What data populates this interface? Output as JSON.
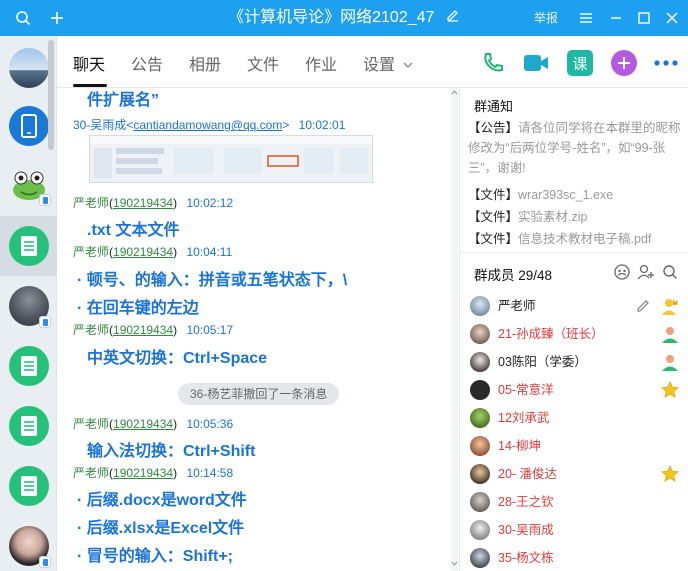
{
  "window": {
    "title": "《计算机导论》网络2102_47",
    "report": "举报",
    "colors": {
      "titlebar": "#1ea0f0",
      "accent": "#1a73d9",
      "green": "#2e8b3d",
      "red": "#e03a3a"
    }
  },
  "tabs": [
    {
      "label": "聊天"
    },
    {
      "label": "公告"
    },
    {
      "label": "相册"
    },
    {
      "label": "文件"
    },
    {
      "label": "作业"
    },
    {
      "label": "设置"
    }
  ],
  "toolbar": {
    "course_label": "课"
  },
  "chat": {
    "messages": [
      {
        "kind": "text",
        "text": "件扩展名”"
      },
      {
        "kind": "sender",
        "name": "30-吴雨成",
        "email": "cantiandamowang@qq.com",
        "time": "10:02:01"
      },
      {
        "kind": "sender",
        "name": "严老师",
        "qq": "190219434",
        "time": "10:02:12"
      },
      {
        "kind": "text",
        "text": ".txt  文本文件"
      },
      {
        "kind": "sender",
        "name": "严老师",
        "qq": "190219434",
        "time": "10:04:11"
      },
      {
        "kind": "text",
        "text": "· 顿号、的输入：拼音或五笔状态下，\\"
      },
      {
        "kind": "text",
        "text": "· 在回车键的左边"
      },
      {
        "kind": "sender",
        "name": "严老师",
        "qq": "190219434",
        "time": "10:05:17"
      },
      {
        "kind": "text",
        "text": "中英文切换：Ctrl+Space"
      },
      {
        "kind": "system",
        "text": "36-杨艺菲撤回了一条消息"
      },
      {
        "kind": "sender",
        "name": "严老师",
        "qq": "190219434",
        "time": "10:05:36"
      },
      {
        "kind": "text",
        "text": "输入法切换：Ctrl+Shift"
      },
      {
        "kind": "sender",
        "name": "严老师",
        "qq": "190219434",
        "time": "10:14:58"
      },
      {
        "kind": "text",
        "text": "· 后缀.docx是word文件"
      },
      {
        "kind": "text",
        "text": "· 后缀.xlsx是Excel文件"
      },
      {
        "kind": "text",
        "text": "· 冒号的输入：Shift+;"
      }
    ]
  },
  "notice": {
    "title": "群通知",
    "tag": "【公告】",
    "body": "请各位同学将在本群里的昵称修改为“后两位学号-姓名”，如“99-张三”，谢谢!",
    "files": [
      {
        "tag": "【文件】",
        "name": "wrar393sc_1.exe"
      },
      {
        "tag": "【文件】",
        "name": "实验素材.zip"
      },
      {
        "tag": "【文件】",
        "name": "信息技术教材电子稿.pdf"
      }
    ]
  },
  "members": {
    "title": "群成员 29/48",
    "list": [
      {
        "name": "严老师",
        "color": "#222222",
        "role": "owner"
      },
      {
        "name": "21-孙成臻（班长）",
        "color": "#e03a3a",
        "role": "admin"
      },
      {
        "name": "03陈阳（学委）",
        "color": "#222222",
        "role": "admin"
      },
      {
        "name": "05-常意洋",
        "color": "#e03a3a",
        "role": "star"
      },
      {
        "name": "12刘承武",
        "color": "#e03a3a",
        "role": ""
      },
      {
        "name": "14-柳坤",
        "color": "#e03a3a",
        "role": ""
      },
      {
        "name": "20- 潘俊达",
        "color": "#e03a3a",
        "role": "star"
      },
      {
        "name": "28-王之钦",
        "color": "#e03a3a",
        "role": ""
      },
      {
        "name": "30-吴雨成",
        "color": "#e03a3a",
        "role": ""
      },
      {
        "name": "35-杨文栋",
        "color": "#e03a3a",
        "role": ""
      }
    ]
  }
}
